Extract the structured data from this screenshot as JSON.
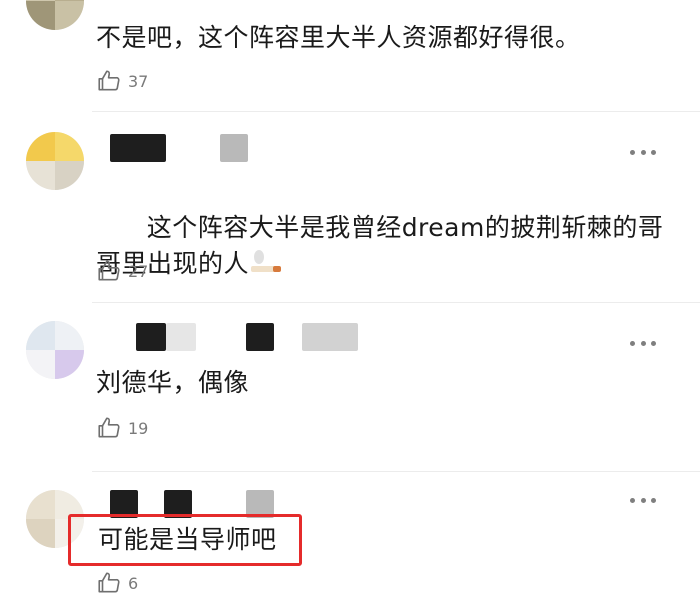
{
  "comments": [
    {
      "text": "不是吧，这个阵容里大半人资源都好得很。",
      "likes": "37"
    },
    {
      "text": "这个阵容大半是我曾经dream的披荆斩棘的哥哥里出现的人",
      "likes": "27",
      "emoji_icon": "smoking-icon"
    },
    {
      "text": "刘德华，偶像",
      "likes": "19"
    },
    {
      "text": "可能是当导师吧",
      "likes": "6"
    }
  ],
  "colors": {
    "highlight": "#e52b2b",
    "meta_text": "#7a7a7a",
    "divider": "#ececec"
  },
  "icons": {
    "like": "thumbs-up-icon",
    "more": "more-dots-icon"
  }
}
